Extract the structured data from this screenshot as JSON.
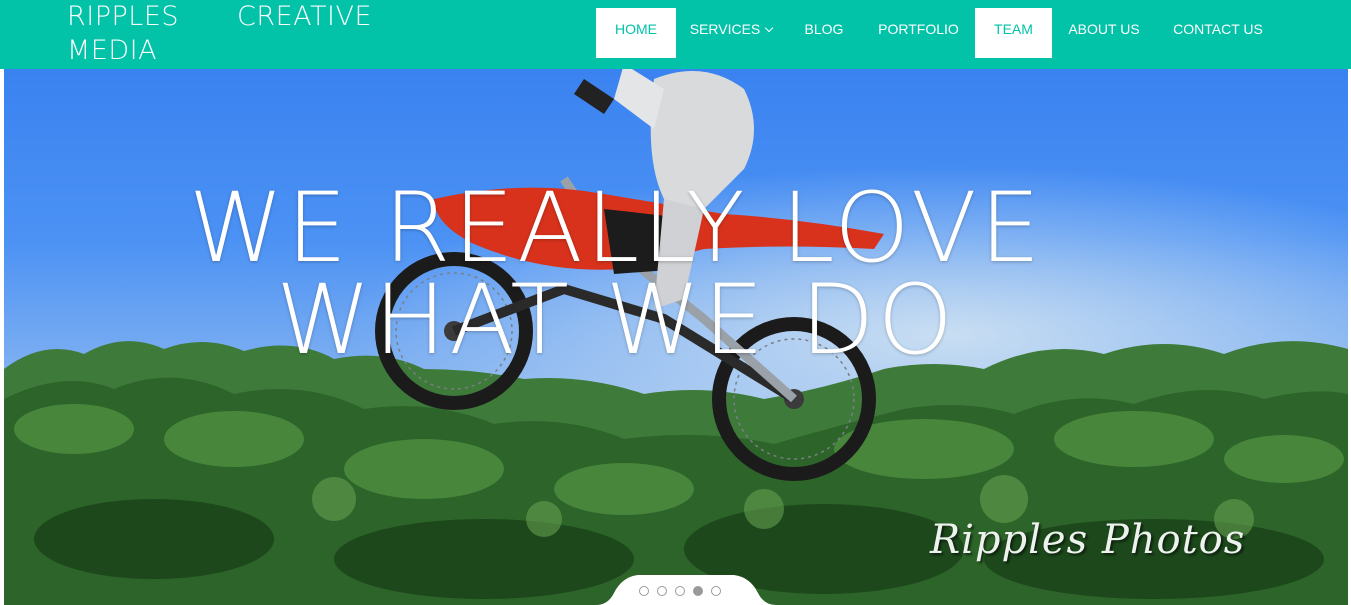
{
  "brand": {
    "line1_word1": "RIPPLES",
    "line1_word2": "CREATIVE",
    "line2": "MEDIA"
  },
  "nav": {
    "items": [
      {
        "label": "HOME",
        "active": true
      },
      {
        "label": "SERVICES",
        "has_dropdown": true
      },
      {
        "label": "BLOG"
      },
      {
        "label": "PORTFOLIO"
      },
      {
        "label": "TEAM",
        "active": true
      },
      {
        "label": "ABOUT US"
      },
      {
        "label": "CONTACT US"
      }
    ]
  },
  "hero": {
    "headline_line1": "WE REALLY LOVE",
    "headline_line2": "WHAT WE DO",
    "watermark": "Ripples Photos"
  },
  "slider": {
    "slide_count": 5,
    "active_index": 4
  },
  "colors": {
    "accent": "#02c2a8",
    "white": "#ffffff"
  }
}
